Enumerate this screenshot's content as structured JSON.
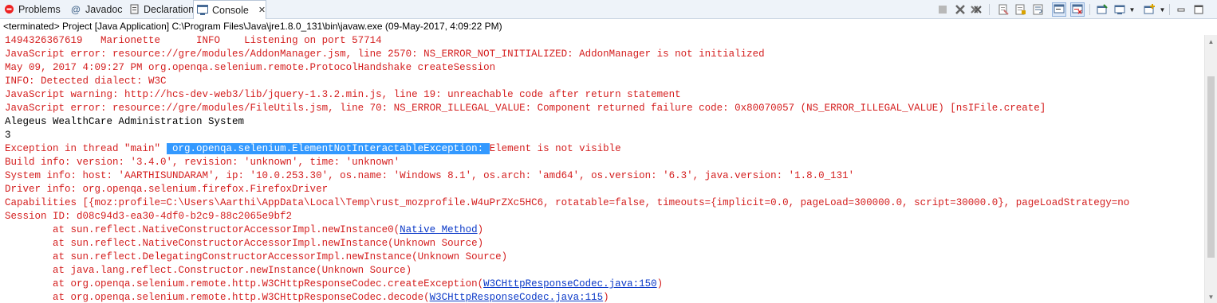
{
  "tabs": [
    {
      "label": "Problems",
      "icon": "problems-icon",
      "active": false
    },
    {
      "label": "Javadoc",
      "icon": "javadoc-icon",
      "active": false
    },
    {
      "label": "Declaration",
      "icon": "declaration-icon",
      "active": false
    },
    {
      "label": "Console",
      "icon": "console-icon",
      "active": true
    }
  ],
  "active_tab_close": "✕",
  "toolbar": [
    {
      "name": "terminate-icon"
    },
    {
      "name": "remove-launch-icon"
    },
    {
      "name": "remove-all-terminated-icon"
    },
    {
      "name": "clear-console-icon"
    },
    {
      "name": "scroll-lock-icon"
    },
    {
      "name": "word-wrap-icon"
    },
    {
      "name": "show-console-on-stdout-icon"
    },
    {
      "name": "show-console-on-stderr-icon"
    },
    {
      "name": "pin-console-icon"
    },
    {
      "name": "display-selected-console-icon"
    },
    {
      "name": "open-console-icon"
    },
    {
      "name": "minimize-icon"
    },
    {
      "name": "maximize-icon"
    }
  ],
  "status_line": "<terminated> Project [Java Application] C:\\Program Files\\Java\\jre1.8.0_131\\bin\\javaw.exe (09-May-2017, 4:09:22 PM)",
  "console_lines": [
    {
      "style": "err",
      "text": "1494326367619\tMarionette\tINFO\tListening on port 57714"
    },
    {
      "style": "err",
      "text": "JavaScript error: resource://gre/modules/AddonManager.jsm, line 2570: NS_ERROR_NOT_INITIALIZED: AddonManager is not initialized"
    },
    {
      "style": "err",
      "text": "May 09, 2017 4:09:27 PM org.openqa.selenium.remote.ProtocolHandshake createSession"
    },
    {
      "style": "err",
      "text": "INFO: Detected dialect: W3C"
    },
    {
      "style": "err",
      "text": "JavaScript warning: http://hcs-dev-web3/lib/jquery-1.3.2.min.js, line 19: unreachable code after return statement"
    },
    {
      "style": "err",
      "text": "JavaScript error: resource://gre/modules/FileUtils.jsm, line 70: NS_ERROR_ILLEGAL_VALUE: Component returned failure code: 0x80070057 (NS_ERROR_ILLEGAL_VALUE) [nsIFile.create]"
    },
    {
      "style": "out",
      "text": "Alegeus WealthCare Administration System"
    },
    {
      "style": "out",
      "text": "3"
    },
    {
      "style": "err",
      "text": "Exception in thread \"main\" ",
      "highlight": " org.openqa.selenium.ElementNotInteractableException: ",
      "after": "Element is not visible"
    },
    {
      "style": "err",
      "text": "Build info: version: '3.4.0', revision: 'unknown', time: 'unknown'"
    },
    {
      "style": "err",
      "text": "System info: host: 'AARTHISUNDARAM', ip: '10.0.253.30', os.name: 'Windows 8.1', os.arch: 'amd64', os.version: '6.3', java.version: '1.8.0_131'"
    },
    {
      "style": "err",
      "text": "Driver info: org.openqa.selenium.firefox.FirefoxDriver"
    },
    {
      "style": "err",
      "text": "Capabilities [{moz:profile=C:\\Users\\Aarthi\\AppData\\Local\\Temp\\rust_mozprofile.W4uPrZXc5HC6, rotatable=false, timeouts={implicit=0.0, pageLoad=300000.0, script=30000.0}, pageLoadStrategy=no"
    },
    {
      "style": "err",
      "text": "Session ID: d08c94d3-ea30-4df0-b2c9-88c2065e9bf2"
    },
    {
      "style": "err",
      "text": "\tat sun.reflect.NativeConstructorAccessorImpl.newInstance0(",
      "link": "Native Method",
      "after": ")"
    },
    {
      "style": "err",
      "text": "\tat sun.reflect.NativeConstructorAccessorImpl.newInstance(Unknown Source)"
    },
    {
      "style": "err",
      "text": "\tat sun.reflect.DelegatingConstructorAccessorImpl.newInstance(Unknown Source)"
    },
    {
      "style": "err",
      "text": "\tat java.lang.reflect.Constructor.newInstance(Unknown Source)"
    },
    {
      "style": "err",
      "text": "\tat org.openqa.selenium.remote.http.W3CHttpResponseCodec.createException(",
      "link": "W3CHttpResponseCodec.java:150",
      "after": ")"
    },
    {
      "style": "err",
      "text": "\tat org.openqa.selenium.remote.http.W3CHttpResponseCodec.decode(",
      "link": "W3CHttpResponseCodec.java:115",
      "after": ")"
    }
  ],
  "scrollbar": {
    "up": "▲",
    "down": "▼"
  }
}
